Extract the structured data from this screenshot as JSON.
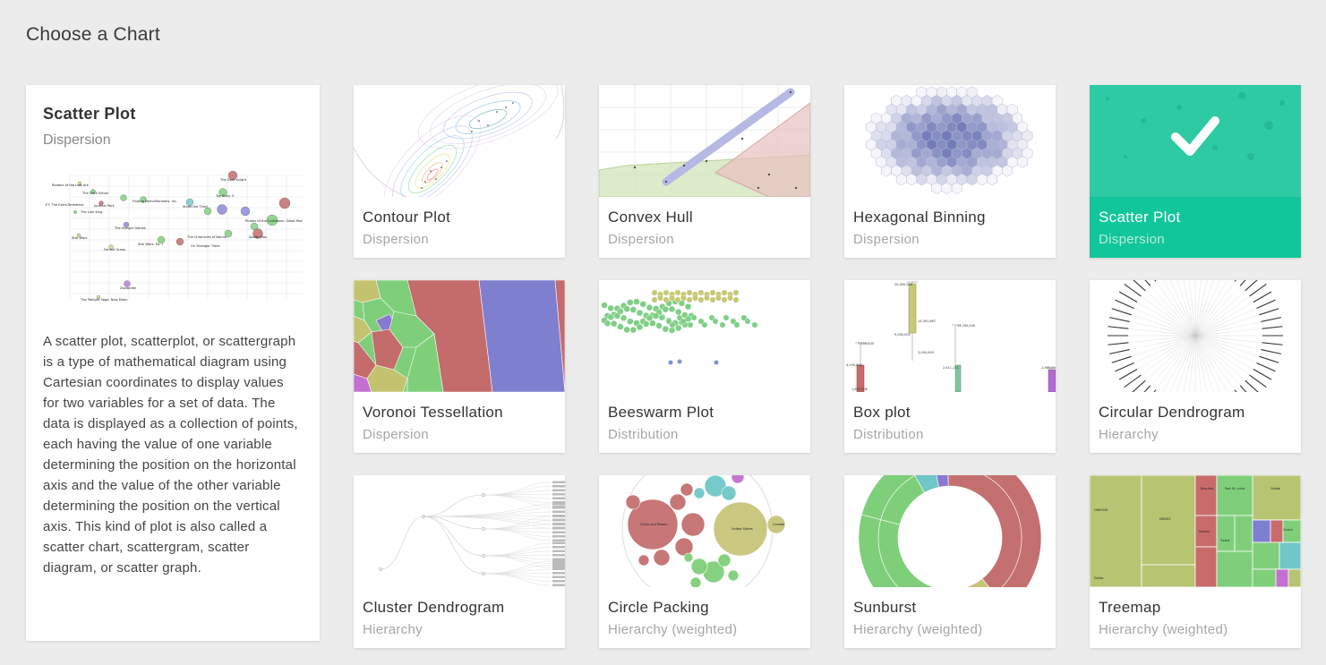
{
  "page": {
    "title": "Choose a Chart"
  },
  "selected_chart": {
    "title": "Scatter Plot",
    "category": "Dispersion",
    "description": "A scatter plot, scatterplot, or scattergraph is a type of mathematical diagram using Cartesian coordinates to display values for two variables for a set of data. The data is displayed as a collection of points, each having the value of one variable determining the position on the horizontal axis and the value of the other variable determining the position on the vertical axis. This kind of plot is also called a scatter chart, scattergram, scatter diagram, or scatter graph."
  },
  "charts": [
    {
      "title": "Contour Plot",
      "category": "Dispersion",
      "selected": false
    },
    {
      "title": "Convex Hull",
      "category": "Dispersion",
      "selected": false
    },
    {
      "title": "Hexagonal Binning",
      "category": "Dispersion",
      "selected": false
    },
    {
      "title": "Scatter Plot",
      "category": "Dispersion",
      "selected": true
    },
    {
      "title": "Voronoi Tessellation",
      "category": "Dispersion",
      "selected": false
    },
    {
      "title": "Beeswarm Plot",
      "category": "Distribution",
      "selected": false
    },
    {
      "title": "Box plot",
      "category": "Distribution",
      "selected": false
    },
    {
      "title": "Circular Dendrogram",
      "category": "Hierarchy",
      "selected": false
    },
    {
      "title": "Cluster Dendrogram",
      "category": "Hierarchy",
      "selected": false
    },
    {
      "title": "Circle Packing",
      "category": "Hierarchy (weighted)",
      "selected": false
    },
    {
      "title": "Sunburst",
      "category": "Hierarchy (weighted)",
      "selected": false
    },
    {
      "title": "Treemap",
      "category": "Hierarchy (weighted)",
      "selected": false
    }
  ],
  "icons": {
    "selected_indicator": "checkmark-icon"
  },
  "colors": {
    "selected_accent": "#12c69b",
    "background": "#ececec"
  }
}
